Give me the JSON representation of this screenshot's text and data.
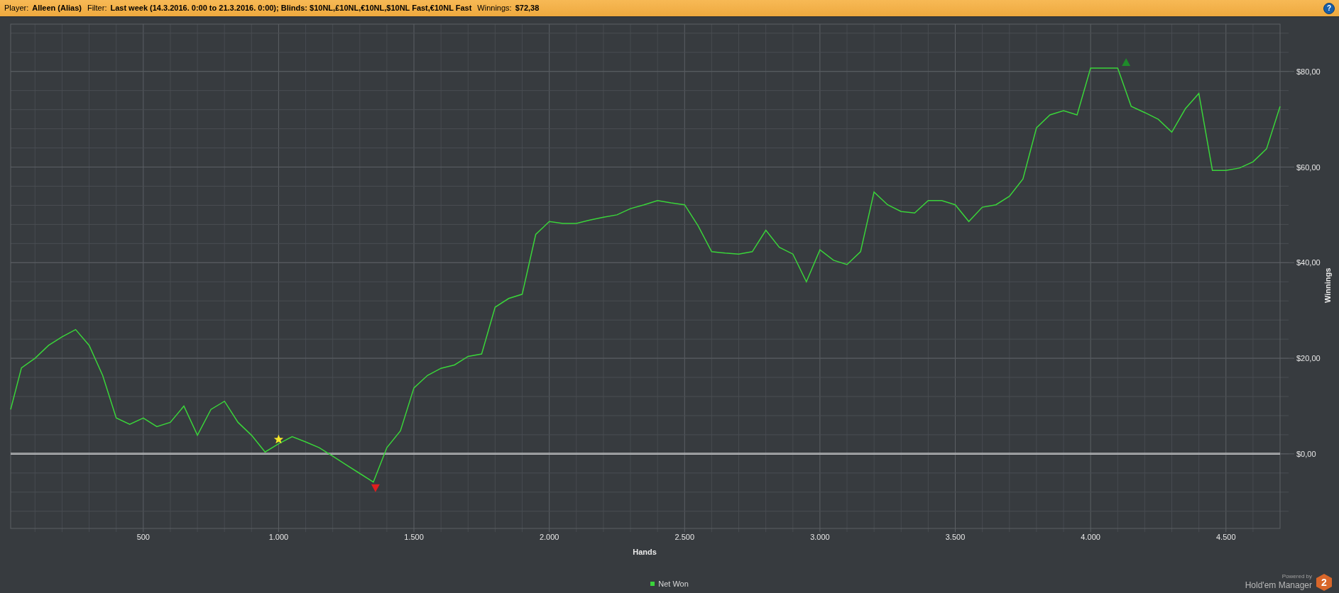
{
  "header": {
    "fields": [
      {
        "label": "Player:",
        "value": "Alleen (Alias)"
      },
      {
        "label": "Filter:",
        "value": "Last week (14.3.2016. 0:00 to 21.3.2016. 0:00); Blinds: $10NL,£10NL,€10NL,$10NL Fast,€10NL Fast"
      },
      {
        "label": "Winnings:",
        "value": "$72,38"
      }
    ],
    "help_button": "?"
  },
  "chart": {
    "chart_data": {
      "type": "line",
      "xlabel": "Hands",
      "ylabel": "Winnings",
      "xlim": [
        10,
        4700
      ],
      "ylim": [
        -15.6,
        89.9
      ],
      "grid": true,
      "x": [
        10,
        50,
        100,
        150,
        200,
        250,
        300,
        350,
        400,
        450,
        500,
        550,
        600,
        650,
        700,
        750,
        800,
        850,
        900,
        950,
        1000,
        1050,
        1100,
        1150,
        1200,
        1250,
        1300,
        1350,
        1400,
        1450,
        1500,
        1550,
        1600,
        1650,
        1700,
        1750,
        1800,
        1850,
        1900,
        1950,
        2000,
        2050,
        2100,
        2150,
        2200,
        2250,
        2300,
        2350,
        2400,
        2450,
        2500,
        2550,
        2600,
        2650,
        2700,
        2750,
        2800,
        2850,
        2900,
        2950,
        3000,
        3050,
        3100,
        3150,
        3200,
        3250,
        3300,
        3350,
        3400,
        3450,
        3500,
        3550,
        3600,
        3650,
        3700,
        3750,
        3800,
        3850,
        3900,
        3950,
        4000,
        4050,
        4100,
        4150,
        4200,
        4250,
        4300,
        4350,
        4400,
        4450,
        4500,
        4550,
        4600,
        4650,
        4700
      ],
      "series": [
        {
          "name": "Net Won",
          "color": "#3ad43a",
          "values": [
            9.3,
            18,
            20,
            22.7,
            24.5,
            26,
            22.7,
            16.4,
            7.5,
            6.2,
            7.5,
            5.7,
            6.6,
            10,
            3.9,
            9.3,
            11,
            6.6,
            3.9,
            0.4,
            2.1,
            3.6,
            2.5,
            1.3,
            -0.5,
            -2.3,
            -4.1,
            -5.9,
            1.3,
            4.8,
            13.8,
            16.4,
            17.9,
            18.6,
            20.4,
            20.9,
            30.7,
            32.5,
            33.4,
            45.9,
            48.6,
            48.2,
            48.2,
            48.9,
            49.5,
            50,
            51.3,
            52.1,
            53,
            52.5,
            52.1,
            47.7,
            42.3,
            42,
            41.8,
            42.3,
            46.8,
            43.2,
            41.8,
            36,
            42.7,
            40.5,
            39.6,
            42.3,
            54.8,
            52.1,
            50.7,
            50.4,
            53,
            53,
            52.1,
            48.6,
            51.6,
            52.1,
            53.9,
            57.5,
            68.2,
            70.9,
            71.8,
            70.9,
            80.7,
            80.7,
            80.7,
            72.7,
            71.4,
            70,
            67.3,
            72.2,
            75.4,
            59.3,
            59.3,
            59.8,
            61.1,
            63.8,
            72.7
          ]
        }
      ],
      "xticks": [
        {
          "value": 500,
          "label": "500"
        },
        {
          "value": 1000,
          "label": "1.000"
        },
        {
          "value": 1500,
          "label": "1.500"
        },
        {
          "value": 2000,
          "label": "2.000"
        },
        {
          "value": 2500,
          "label": "2.500"
        },
        {
          "value": 3000,
          "label": "3.000"
        },
        {
          "value": 3500,
          "label": "3.500"
        },
        {
          "value": 4000,
          "label": "4.000"
        },
        {
          "value": 4500,
          "label": "4.500"
        }
      ],
      "yticks": [
        {
          "value": 0,
          "label": "$0,00"
        },
        {
          "value": 20,
          "label": "$20,00"
        },
        {
          "value": 40,
          "label": "$40,00"
        },
        {
          "value": 60,
          "label": "$60,00"
        },
        {
          "value": 80,
          "label": "$80,00"
        }
      ]
    },
    "markers": [
      {
        "kind": "star",
        "color": "#f5e62a"
      },
      {
        "kind": "down-triangle",
        "color": "#e01e1e"
      },
      {
        "kind": "up-triangle",
        "color": "#1e8a2a"
      }
    ]
  },
  "branding": {
    "powered_by": "Powered by",
    "product": "Hold'em Manager",
    "badge": "2"
  }
}
